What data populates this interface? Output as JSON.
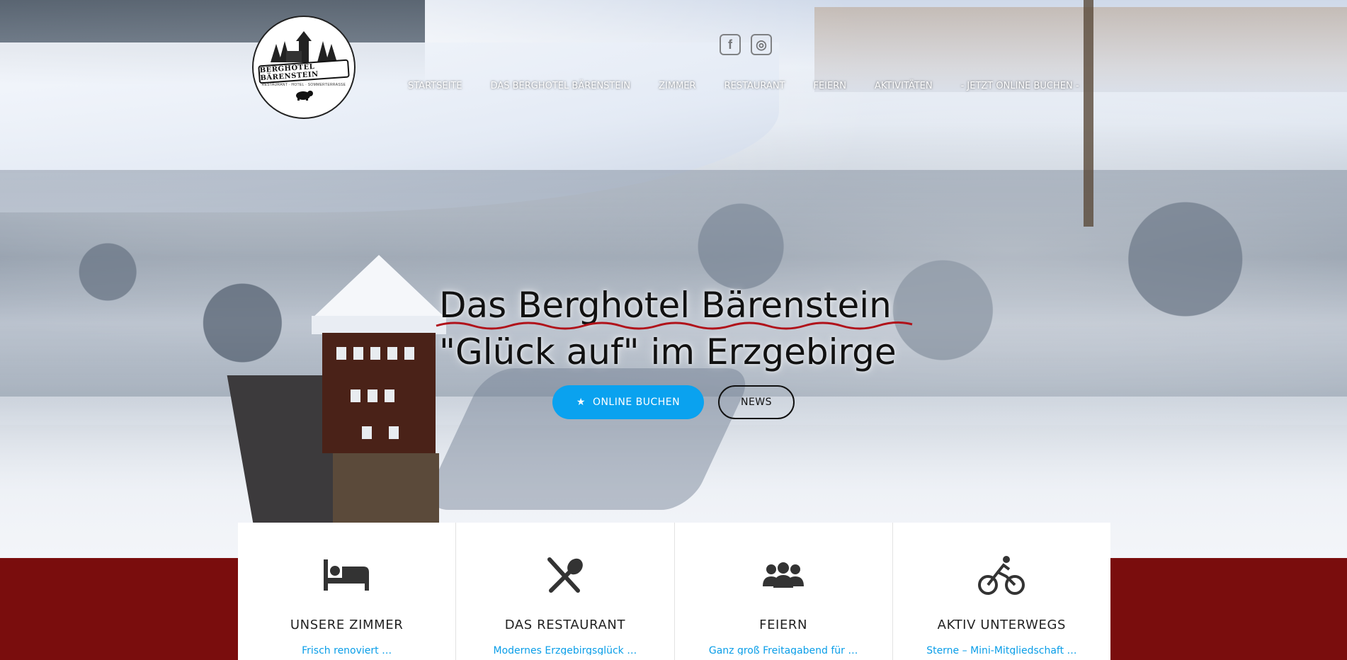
{
  "brand": {
    "logo_title": "BERGHOTEL BÄRENSTEIN",
    "logo_subtitle": "RESTAURANT · HOTEL · SOMMERTERRASSE"
  },
  "social": [
    {
      "icon": "facebook-icon",
      "glyph": "f"
    },
    {
      "icon": "instagram-icon",
      "glyph": "◎"
    }
  ],
  "nav": {
    "items": [
      {
        "label": "Startseite"
      },
      {
        "label": "Das Berghotel Bärenstein"
      },
      {
        "label": "Zimmer"
      },
      {
        "label": "Restaurant"
      },
      {
        "label": "Feiern"
      },
      {
        "label": "Aktivitäten"
      },
      {
        "label": "- Jetzt online buchen -"
      }
    ]
  },
  "hero": {
    "title_line1": "Das Berghotel Bärenstein",
    "title_line2": "\"Glück auf\" im Erzgebirge",
    "primary_button": "Online buchen",
    "secondary_button": "News"
  },
  "features": [
    {
      "icon": "bed-icon",
      "title": "Unsere Zimmer",
      "desc": "Frisch renoviert …"
    },
    {
      "icon": "fork-spoon-icon",
      "title": "Das Restaurant",
      "desc": "Modernes Erzgebirgsglück …"
    },
    {
      "icon": "group-icon",
      "title": "Feiern",
      "desc": "Ganz groß Freitagabend für …"
    },
    {
      "icon": "bicycle-icon",
      "title": "Aktiv unterwegs",
      "desc": "Sterne – Mini-Mitgliedschaft …"
    }
  ],
  "colors": {
    "accent": "#0aa2ef",
    "footer_band": "#7a0d0d",
    "squiggle": "#b0121a"
  }
}
